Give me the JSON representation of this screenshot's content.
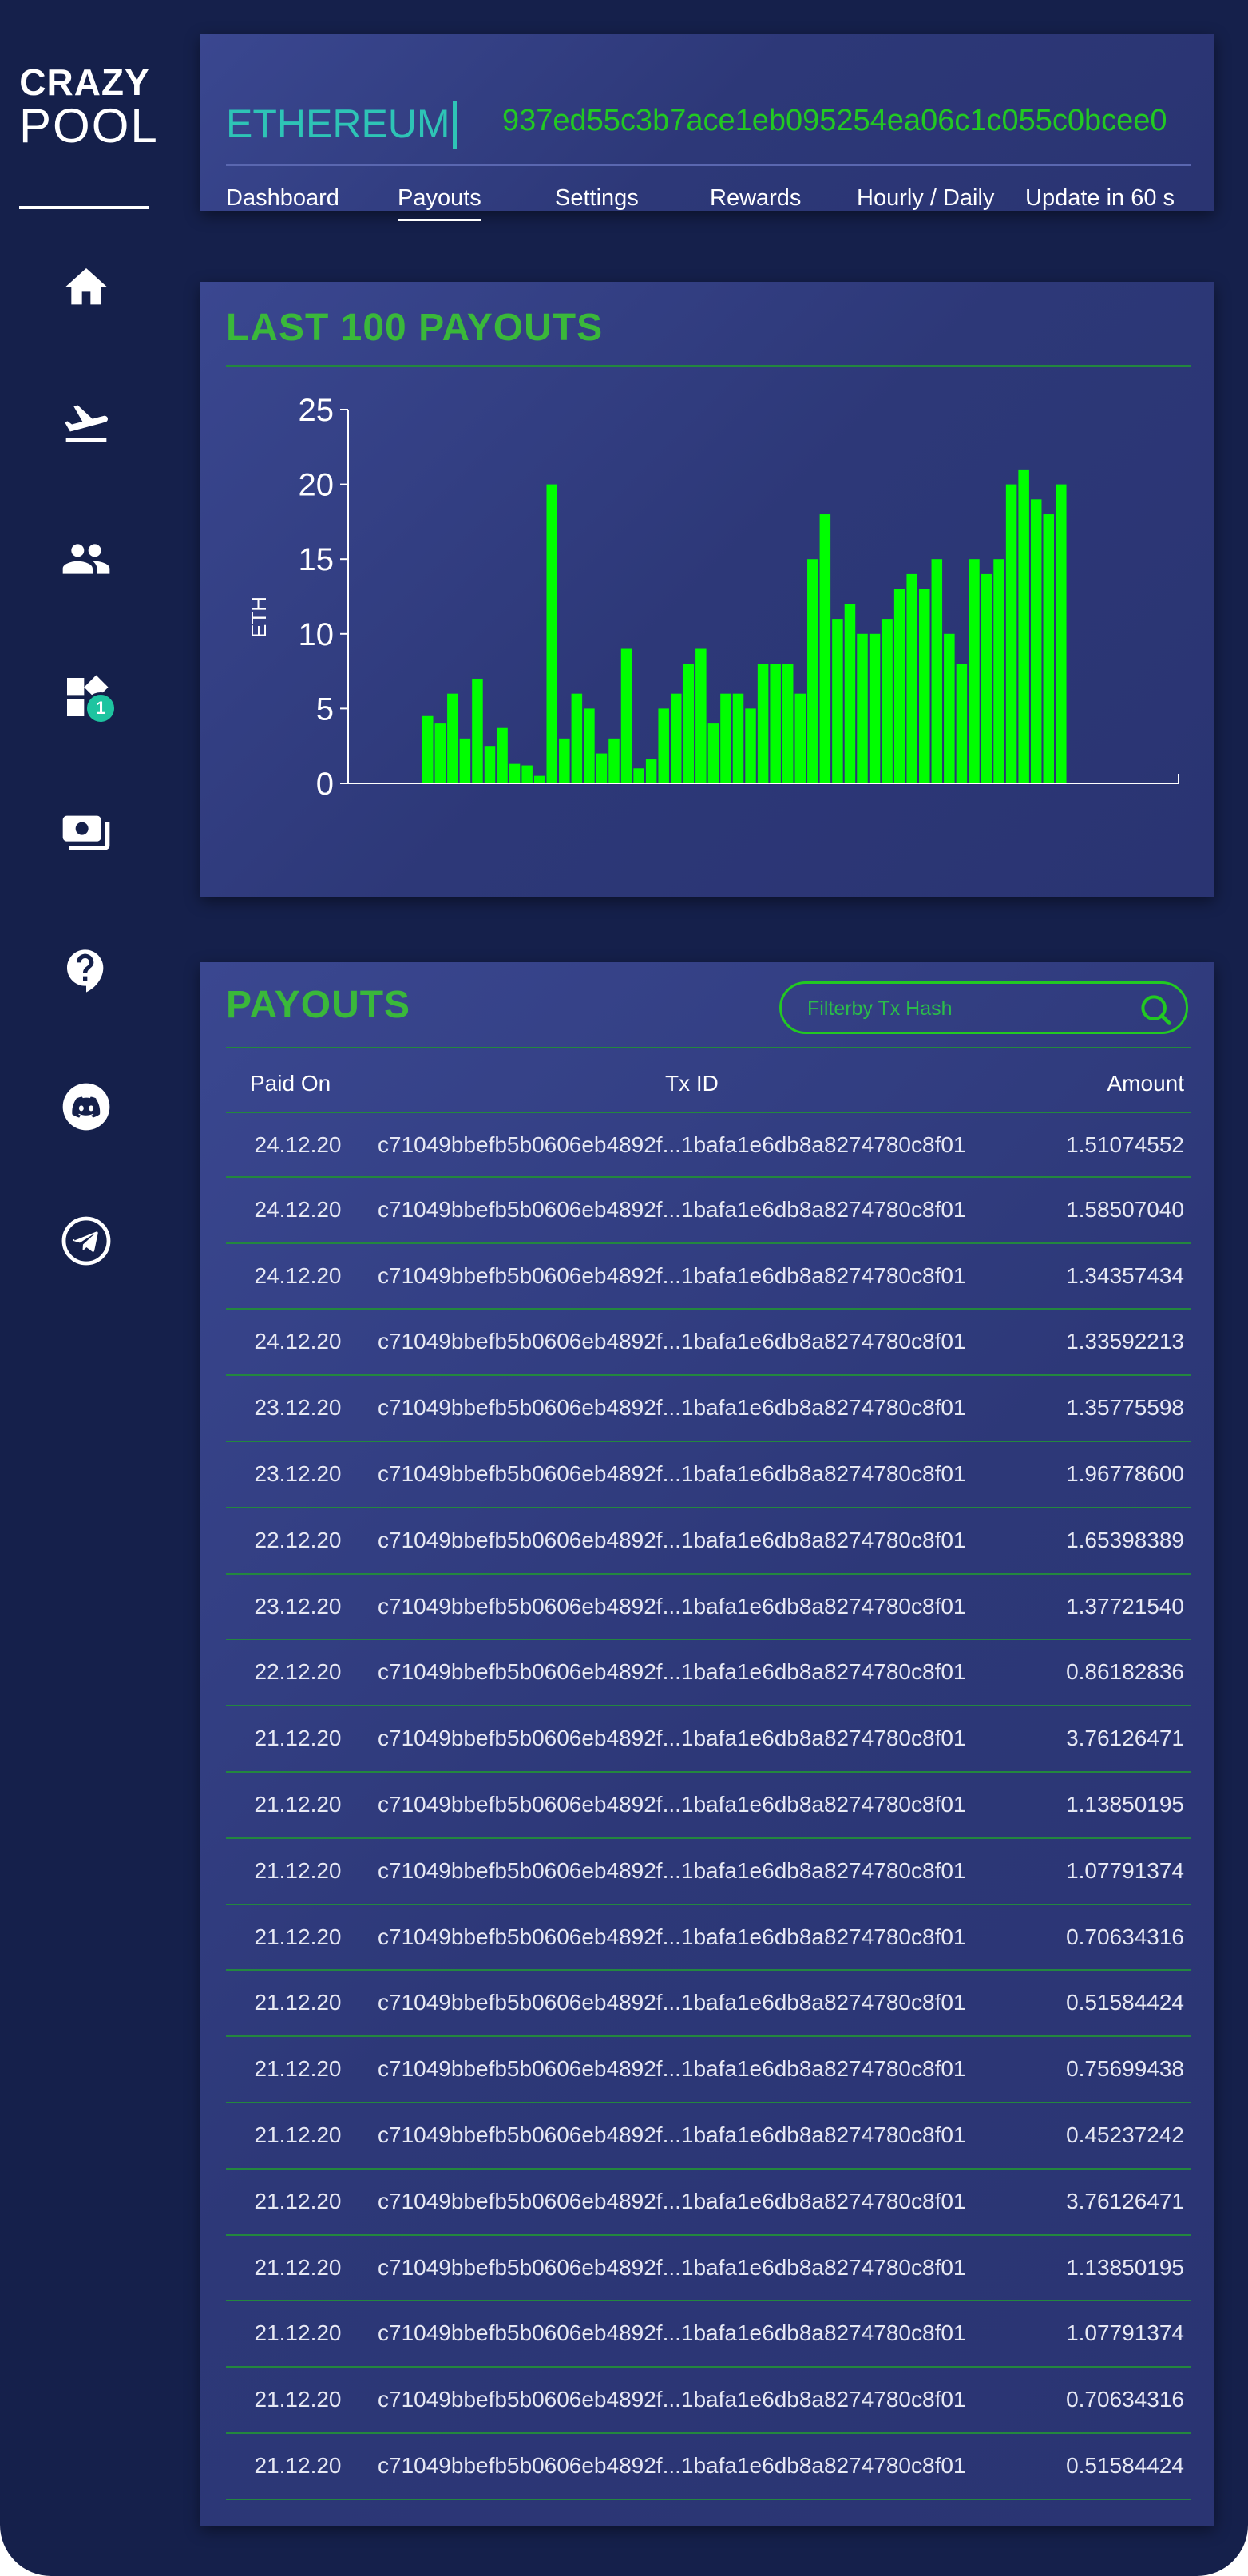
{
  "logo": {
    "top": "CRAZY",
    "bottom": "POOL"
  },
  "sidebar": {
    "items": [
      {
        "icon": "home-icon"
      },
      {
        "icon": "flight-takeoff-icon"
      },
      {
        "icon": "users-icon"
      },
      {
        "icon": "widgets-icon",
        "badge": "1"
      },
      {
        "icon": "payments-icon"
      },
      {
        "icon": "help-icon"
      },
      {
        "icon": "discord-icon"
      },
      {
        "icon": "telegram-icon"
      }
    ]
  },
  "header": {
    "coin": "ETHEREUM",
    "wallet": "937ed55c3b7ace1eb095254ea06c1c055c0bcee0",
    "tabs": [
      {
        "label": "Dashboard"
      },
      {
        "label": "Payouts",
        "active": true
      },
      {
        "label": "Settings"
      },
      {
        "label": "Rewards"
      },
      {
        "label": "Hourly / Daily"
      },
      {
        "label": "Update in 60 s"
      }
    ]
  },
  "chart_section": {
    "title": "LAST 100 PAYOUTS"
  },
  "chart_data": {
    "type": "bar",
    "title": "LAST 100 PAYOUTS",
    "xlabel": "",
    "ylabel": "ETH",
    "ylim": [
      0,
      25
    ],
    "yticks": [
      0,
      5,
      10,
      15,
      20,
      25
    ],
    "grid": false,
    "color": "#00ff00",
    "values": [
      4.5,
      4,
      6,
      3,
      7,
      2.5,
      3.7,
      1.3,
      1.2,
      0.5,
      20,
      3,
      6,
      5,
      2,
      3,
      9,
      1,
      1.6,
      5,
      6,
      8,
      9,
      4,
      6,
      6,
      5,
      8,
      8,
      8,
      6,
      15,
      18,
      11,
      12,
      10,
      10,
      11,
      13,
      14,
      13,
      15,
      10,
      8,
      15,
      14,
      15,
      20,
      21,
      19,
      18,
      20
    ]
  },
  "payouts": {
    "title": "PAYOUTS",
    "search_placeholder": "Filterby Tx Hash",
    "columns": {
      "date": "Paid On",
      "tx": "Tx ID",
      "amount": "Amount"
    },
    "rows": [
      {
        "date": "24.12.20",
        "tx": "c71049bbefb5b0606eb4892f...1bafa1e6db8a8274780c8f01",
        "amount": "1.51074552"
      },
      {
        "date": "24.12.20",
        "tx": "c71049bbefb5b0606eb4892f...1bafa1e6db8a8274780c8f01",
        "amount": "1.58507040"
      },
      {
        "date": "24.12.20",
        "tx": "c71049bbefb5b0606eb4892f...1bafa1e6db8a8274780c8f01",
        "amount": "1.34357434"
      },
      {
        "date": "24.12.20",
        "tx": "c71049bbefb5b0606eb4892f...1bafa1e6db8a8274780c8f01",
        "amount": "1.33592213"
      },
      {
        "date": "23.12.20",
        "tx": "c71049bbefb5b0606eb4892f...1bafa1e6db8a8274780c8f01",
        "amount": "1.35775598"
      },
      {
        "date": "23.12.20",
        "tx": "c71049bbefb5b0606eb4892f...1bafa1e6db8a8274780c8f01",
        "amount": "1.96778600"
      },
      {
        "date": "22.12.20",
        "tx": "c71049bbefb5b0606eb4892f...1bafa1e6db8a8274780c8f01",
        "amount": "1.65398389"
      },
      {
        "date": "23.12.20",
        "tx": "c71049bbefb5b0606eb4892f...1bafa1e6db8a8274780c8f01",
        "amount": "1.37721540"
      },
      {
        "date": "22.12.20",
        "tx": "c71049bbefb5b0606eb4892f...1bafa1e6db8a8274780c8f01",
        "amount": "0.86182836"
      },
      {
        "date": "21.12.20",
        "tx": "c71049bbefb5b0606eb4892f...1bafa1e6db8a8274780c8f01",
        "amount": "3.76126471"
      },
      {
        "date": "21.12.20",
        "tx": "c71049bbefb5b0606eb4892f...1bafa1e6db8a8274780c8f01",
        "amount": "1.13850195"
      },
      {
        "date": "21.12.20",
        "tx": "c71049bbefb5b0606eb4892f...1bafa1e6db8a8274780c8f01",
        "amount": "1.07791374"
      },
      {
        "date": "21.12.20",
        "tx": "c71049bbefb5b0606eb4892f...1bafa1e6db8a8274780c8f01",
        "amount": "0.70634316"
      },
      {
        "date": "21.12.20",
        "tx": "c71049bbefb5b0606eb4892f...1bafa1e6db8a8274780c8f01",
        "amount": "0.51584424"
      },
      {
        "date": "21.12.20",
        "tx": "c71049bbefb5b0606eb4892f...1bafa1e6db8a8274780c8f01",
        "amount": "0.75699438"
      },
      {
        "date": "21.12.20",
        "tx": "c71049bbefb5b0606eb4892f...1bafa1e6db8a8274780c8f01",
        "amount": "0.45237242"
      },
      {
        "date": "21.12.20",
        "tx": "c71049bbefb5b0606eb4892f...1bafa1e6db8a8274780c8f01",
        "amount": "3.76126471"
      },
      {
        "date": "21.12.20",
        "tx": "c71049bbefb5b0606eb4892f...1bafa1e6db8a8274780c8f01",
        "amount": "1.13850195"
      },
      {
        "date": "21.12.20",
        "tx": "c71049bbefb5b0606eb4892f...1bafa1e6db8a8274780c8f01",
        "amount": "1.07791374"
      },
      {
        "date": "21.12.20",
        "tx": "c71049bbefb5b0606eb4892f...1bafa1e6db8a8274780c8f01",
        "amount": "0.70634316"
      },
      {
        "date": "21.12.20",
        "tx": "c71049bbefb5b0606eb4892f...1bafa1e6db8a8274780c8f01",
        "amount": "0.51584424"
      }
    ]
  },
  "colors": {
    "background": "#15204b",
    "panel": "#333f85",
    "accent_green": "#22c922",
    "teal": "#2ec4b6",
    "bar": "#00ff00"
  }
}
